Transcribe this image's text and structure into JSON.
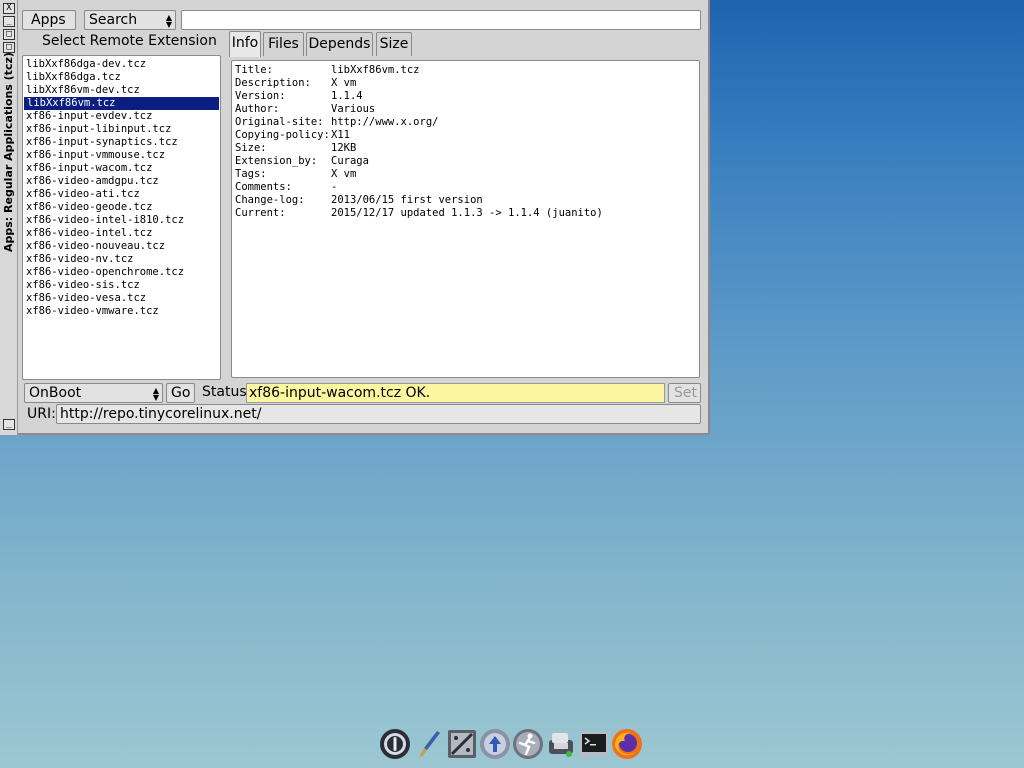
{
  "window": {
    "title": "Apps: Regular Applications (tcz)",
    "titlebar_buttons": [
      "X",
      "_",
      "□",
      "□"
    ],
    "bottom_button": "_"
  },
  "toolbar": {
    "apps_label": "Apps",
    "search_label": "Search",
    "search_value": ""
  },
  "extensions": {
    "header": "Select Remote Extension",
    "selected": "libXxf86vm.tcz",
    "items": [
      "libXxf86dga-dev.tcz",
      "libXxf86dga.tcz",
      "libXxf86vm-dev.tcz",
      "libXxf86vm.tcz",
      "xf86-input-evdev.tcz",
      "xf86-input-libinput.tcz",
      "xf86-input-synaptics.tcz",
      "xf86-input-vmmouse.tcz",
      "xf86-input-wacom.tcz",
      "xf86-video-amdgpu.tcz",
      "xf86-video-ati.tcz",
      "xf86-video-geode.tcz",
      "xf86-video-intel-i810.tcz",
      "xf86-video-intel.tcz",
      "xf86-video-nouveau.tcz",
      "xf86-video-nv.tcz",
      "xf86-video-openchrome.tcz",
      "xf86-video-sis.tcz",
      "xf86-video-vesa.tcz",
      "xf86-video-vmware.tcz"
    ]
  },
  "tabs": {
    "info": "Info",
    "files": "Files",
    "depends": "Depends",
    "size": "Size",
    "active": "Info"
  },
  "info": {
    "rows": [
      {
        "key": "Title:",
        "value": "libXxf86vm.tcz"
      },
      {
        "key": "Description:",
        "value": "X vm"
      },
      {
        "key": "Version:",
        "value": "1.1.4"
      },
      {
        "key": "Author:",
        "value": "Various"
      },
      {
        "key": "Original-site:",
        "value": "http://www.x.org/"
      },
      {
        "key": "Copying-policy:",
        "value": "X11"
      },
      {
        "key": "Size:",
        "value": "12KB"
      },
      {
        "key": "Extension_by:",
        "value": "Curaga"
      },
      {
        "key": "Tags:",
        "value": "X vm"
      },
      {
        "key": "Comments:",
        "value": "-"
      },
      {
        "key": "Change-log:",
        "value": "2013/06/15 first version"
      },
      {
        "key": "Current:",
        "value": "2015/12/17 updated 1.1.3 -> 1.1.4 (juanito)"
      }
    ]
  },
  "bottom": {
    "install_mode": "OnBoot",
    "go_label": "Go",
    "status_label": "Status",
    "status_value": "xf86-input-wacom.tcz OK.",
    "set_label": "Set",
    "uri_label": "URI:",
    "uri_value": "http://repo.tinycorelinux.net/"
  },
  "dock": {
    "icons": [
      "power-icon",
      "paintbrush-icon",
      "control-panel-icon",
      "mount-tool-icon",
      "apps-runner-icon",
      "editor-icon",
      "terminal-icon",
      "firefox-icon"
    ]
  },
  "colors": {
    "selection": "#0c1e82",
    "status_bg": "#fbf7a0",
    "window_bg": "#d4d4d4"
  }
}
